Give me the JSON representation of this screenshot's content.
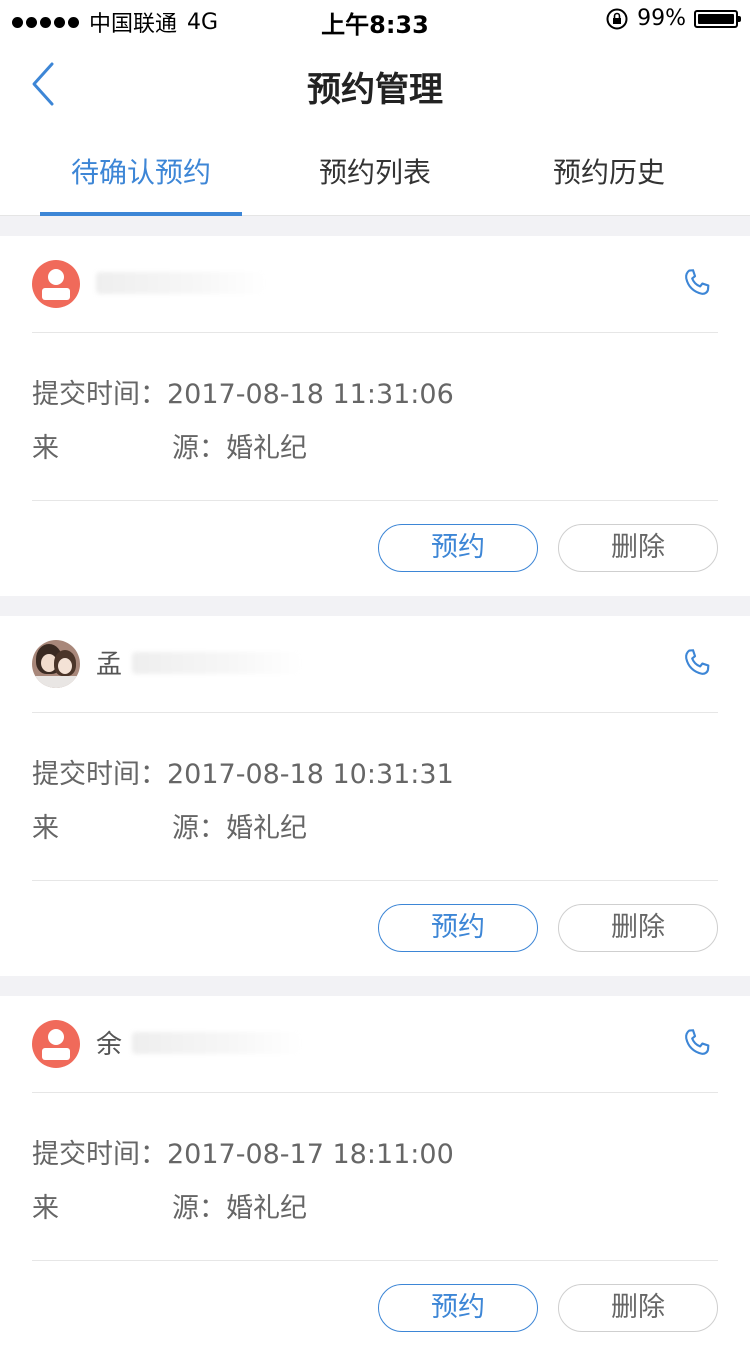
{
  "status_bar": {
    "carrier": "中国联通",
    "network": "4G",
    "time": "上午8:33",
    "battery": "99%",
    "battery_level": 0.99
  },
  "nav": {
    "title": "预约管理",
    "back_icon": "chevron-left-icon"
  },
  "tabs": [
    {
      "label": "待确认预约",
      "active": true
    },
    {
      "label": "预约列表",
      "active": false
    },
    {
      "label": "预约历史",
      "active": false
    }
  ],
  "labels": {
    "submit_time": "提交时间：",
    "source_1": "来",
    "source_2": "源：",
    "book_button": "预约",
    "delete_button": "删除"
  },
  "reservations": [
    {
      "name": "",
      "avatar": "default-avatar",
      "submit_time": "2017-08-18 11:31:06",
      "source": "婚礼纪"
    },
    {
      "name": "孟",
      "avatar": "photo-avatar",
      "submit_time": "2017-08-18 10:31:31",
      "source": "婚礼纪"
    },
    {
      "name": "余",
      "avatar": "default-avatar",
      "submit_time": "2017-08-17 18:11:00",
      "source": "婚礼纪"
    }
  ],
  "colors": {
    "accent": "#3d86d6",
    "avatar_default": "#f06a5a",
    "background": "#f2f2f5"
  }
}
